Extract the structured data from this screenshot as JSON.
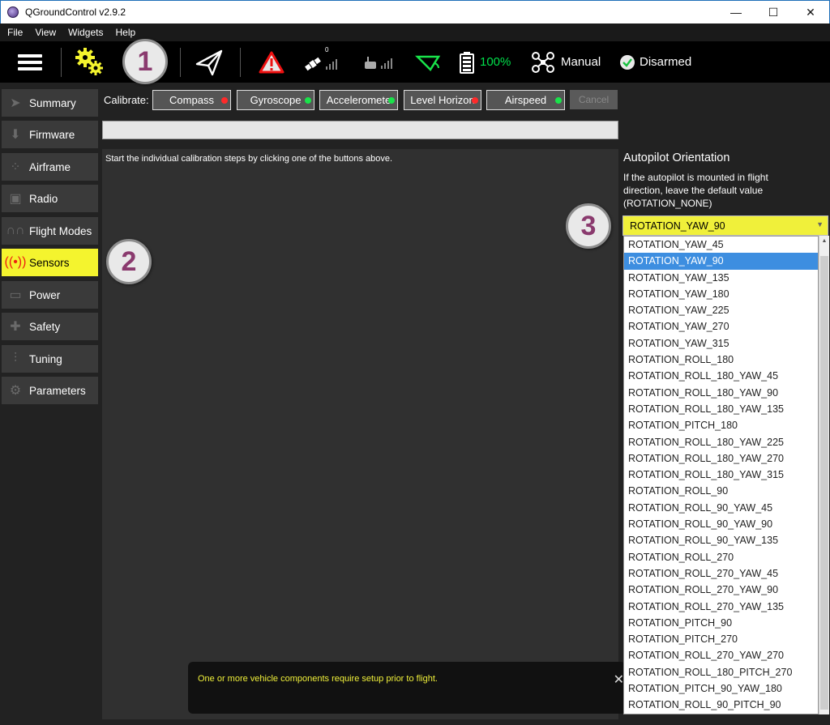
{
  "window": {
    "title": "QGroundControl v2.9.2",
    "minimize": "—",
    "maximize": "☐",
    "close": "✕"
  },
  "menu": [
    "File",
    "View",
    "Widgets",
    "Help"
  ],
  "toolbar": {
    "gps_count": "0",
    "battery": "100%",
    "flight_mode": "Manual",
    "arm_state": "Disarmed"
  },
  "callouts": [
    "1",
    "2",
    "3"
  ],
  "sidebar": [
    {
      "label": "Summary",
      "icon": "paper-plane-icon"
    },
    {
      "label": "Firmware",
      "icon": "download-icon"
    },
    {
      "label": "Airframe",
      "icon": "airframe-icon"
    },
    {
      "label": "Radio",
      "icon": "radio-icon"
    },
    {
      "label": "Flight Modes",
      "icon": "flight-modes-icon"
    },
    {
      "label": "Sensors",
      "icon": "sensors-icon",
      "active": true
    },
    {
      "label": "Power",
      "icon": "battery-icon"
    },
    {
      "label": "Safety",
      "icon": "first-aid-icon"
    },
    {
      "label": "Tuning",
      "icon": "sliders-icon"
    },
    {
      "label": "Parameters",
      "icon": "gears-icon"
    }
  ],
  "calibrate": {
    "label": "Calibrate:",
    "buttons": [
      {
        "label": "Compass",
        "status": "red"
      },
      {
        "label": "Gyroscope",
        "status": "green"
      },
      {
        "label": "Acceleromete",
        "status": "green"
      },
      {
        "label": "Level Horizon",
        "status": "red"
      },
      {
        "label": "Airspeed",
        "status": "green"
      }
    ],
    "cancel": "Cancel"
  },
  "instructions": "Start the individual calibration steps by clicking one of the buttons above.",
  "notice": {
    "text": "One or more vehicle components require setup prior to flight.",
    "close": "✕"
  },
  "orientation": {
    "title": "Autopilot Orientation",
    "description": "If the autopilot is mounted in flight direction, leave the default value (ROTATION_NONE)",
    "selected": "ROTATION_YAW_90",
    "options": [
      "ROTATION_YAW_45",
      "ROTATION_YAW_90",
      "ROTATION_YAW_135",
      "ROTATION_YAW_180",
      "ROTATION_YAW_225",
      "ROTATION_YAW_270",
      "ROTATION_YAW_315",
      "ROTATION_ROLL_180",
      "ROTATION_ROLL_180_YAW_45",
      "ROTATION_ROLL_180_YAW_90",
      "ROTATION_ROLL_180_YAW_135",
      "ROTATION_PITCH_180",
      "ROTATION_ROLL_180_YAW_225",
      "ROTATION_ROLL_180_YAW_270",
      "ROTATION_ROLL_180_YAW_315",
      "ROTATION_ROLL_90",
      "ROTATION_ROLL_90_YAW_45",
      "ROTATION_ROLL_90_YAW_90",
      "ROTATION_ROLL_90_YAW_135",
      "ROTATION_ROLL_270",
      "ROTATION_ROLL_270_YAW_45",
      "ROTATION_ROLL_270_YAW_90",
      "ROTATION_ROLL_270_YAW_135",
      "ROTATION_PITCH_90",
      "ROTATION_PITCH_270",
      "ROTATION_ROLL_270_YAW_270",
      "ROTATION_ROLL_180_PITCH_270",
      "ROTATION_PITCH_90_YAW_180",
      "ROTATION_ROLL_90_PITCH_90"
    ]
  },
  "colors": {
    "accent_yellow": "#f4f42e",
    "status_red": "#ff2a2a",
    "status_green": "#19e34a",
    "highlight": "#3d8ee0"
  }
}
